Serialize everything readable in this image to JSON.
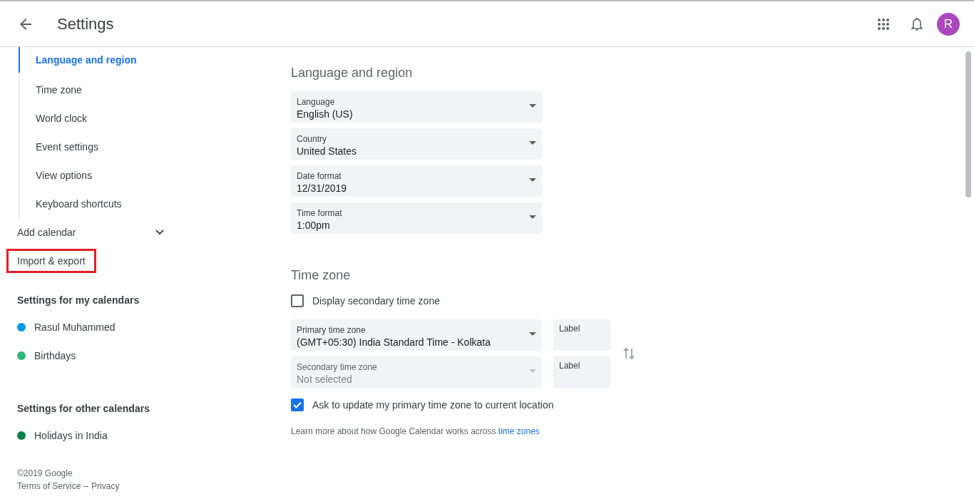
{
  "header": {
    "title": "Settings",
    "avatar": "R"
  },
  "sidebar": {
    "nav_items": [
      {
        "label": "Language and region",
        "selected": true
      },
      {
        "label": "Time zone",
        "selected": false
      },
      {
        "label": "World clock",
        "selected": false
      },
      {
        "label": "Event settings",
        "selected": false
      },
      {
        "label": "View options",
        "selected": false
      },
      {
        "label": "Keyboard shortcuts",
        "selected": false
      }
    ],
    "add_calendar": {
      "label": "Add calendar",
      "expanded": false
    },
    "import_export": {
      "label": "Import & export",
      "highlighted": true
    },
    "calendar_groups": [
      {
        "heading": "Settings for my calendars",
        "items": [
          {
            "name": "Rasul Muhammed",
            "color": "#039be5"
          },
          {
            "name": "Birthdays",
            "color": "#33b679"
          }
        ]
      },
      {
        "heading": "Settings for other calendars",
        "items": [
          {
            "name": "Holidays in India",
            "color": "#0b8043"
          }
        ]
      }
    ],
    "footer": {
      "copyright": "©2019 Google",
      "terms": "Terms of Service",
      "separator": "–",
      "privacy": "Privacy"
    }
  },
  "language_region": {
    "title": "Language and region",
    "selects": [
      {
        "label": "Language",
        "value": "English (US)",
        "disabled": false
      },
      {
        "label": "Country",
        "value": "United States",
        "disabled": false
      },
      {
        "label": "Date format",
        "value": "12/31/2019",
        "disabled": false
      },
      {
        "label": "Time format",
        "value": "1:00pm",
        "disabled": false
      }
    ]
  },
  "time_zone": {
    "title": "Time zone",
    "display_secondary": {
      "label": "Display secondary time zone",
      "checked": false
    },
    "zones": [
      {
        "label": "Primary time zone",
        "value": "(GMT+05:30) India Standard Time - Kolkata",
        "disabled": false,
        "name_field": "Label"
      },
      {
        "label": "Secondary time zone",
        "value": "Not selected",
        "disabled": true,
        "name_field": "Label"
      }
    ],
    "ask_update": {
      "label": "Ask to update my primary time zone to current location",
      "checked": true
    },
    "learn_more": {
      "text": "Learn more about how Google Calendar works across",
      "link": "time zones"
    }
  }
}
